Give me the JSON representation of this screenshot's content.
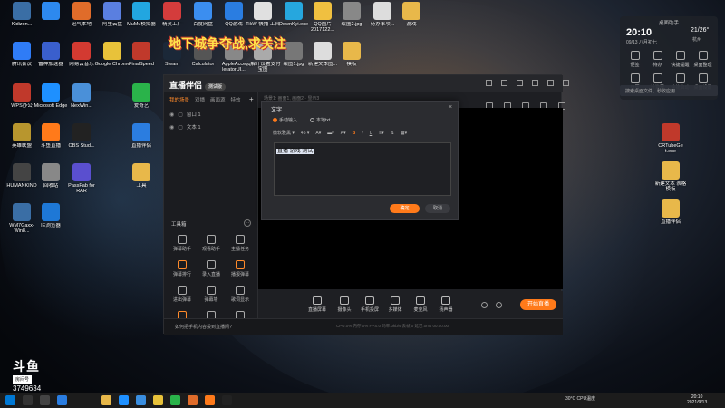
{
  "promo_text": "地下城争夺战,求关注",
  "desktop_icons": [
    {
      "label": "Kidizon...",
      "color": "#3a6ea5",
      "icon": "app-icon"
    },
    {
      "label": "",
      "color": "#2d89ef",
      "icon": "app-icon"
    },
    {
      "label": "迅气本地",
      "color": "#e06c2a",
      "icon": "app-icon"
    },
    {
      "label": "阿里云盘",
      "color": "#5a7fe0",
      "icon": "app-icon"
    },
    {
      "label": "MuMu模拟器",
      "color": "#22a6e0",
      "icon": "app-icon"
    },
    {
      "label": "精灵工厂",
      "color": "#d43c3c",
      "icon": "app-icon"
    },
    {
      "label": "百度网盘",
      "color": "#3b8ef0",
      "icon": "app-icon"
    },
    {
      "label": "QQ游戏",
      "color": "#2a7de1",
      "icon": "app-icon"
    },
    {
      "label": "TikW-快播 工具",
      "color": "#e0e0e0",
      "icon": "app-icon"
    },
    {
      "label": "DownKyi.exe",
      "color": "#26a7de",
      "icon": "app-icon"
    },
    {
      "label": "QQ图片2017122...",
      "color": "#f0c040",
      "icon": "image-icon"
    },
    {
      "label": "绘图2.jpg",
      "color": "#888",
      "icon": "image-icon"
    },
    {
      "label": "待办事项...",
      "color": "#ddd",
      "icon": "file-icon"
    },
    {
      "label": "游戏",
      "color": "#e8b84a",
      "icon": "folder-icon"
    },
    {
      "label": "腾讯会议",
      "color": "#2f7cf6",
      "icon": "app-icon"
    },
    {
      "label": "雷神加速器",
      "color": "#3a5fcd",
      "icon": "app-icon"
    },
    {
      "label": "网易云音乐",
      "color": "#d33a31",
      "icon": "app-icon"
    },
    {
      "label": "Google Chrome",
      "color": "#e8c23a",
      "icon": "chrome-icon"
    },
    {
      "label": "FinalSpeed",
      "color": "#c0392b",
      "icon": "app-icon"
    },
    {
      "label": "Steam",
      "color": "#1b2838",
      "icon": "steam-icon"
    },
    {
      "label": "Calculator",
      "color": "#555",
      "icon": "calculator-icon"
    },
    {
      "label": "AppleAcce leratorUI...",
      "color": "#888",
      "icon": "app-icon"
    },
    {
      "label": "qq解开设置支付宝图",
      "color": "#aaa",
      "icon": "app-icon"
    },
    {
      "label": "绘图1.jpg",
      "color": "#777",
      "icon": "image-icon"
    },
    {
      "label": "新建文本图...",
      "color": "#ddd",
      "icon": "file-icon"
    },
    {
      "label": "模板",
      "color": "#e8b84a",
      "icon": "folder-icon"
    },
    {
      "label": "WPS办公",
      "color": "#c0392b",
      "icon": "app-icon"
    },
    {
      "label": "Microsoft Edge",
      "color": "#1e90ff",
      "icon": "edge-icon"
    },
    {
      "label": "NexWin...",
      "color": "#4a90d9",
      "icon": "app-icon"
    },
    {
      "label": "爱奇艺",
      "color": "#2ab34a",
      "icon": "app-icon"
    },
    {
      "label": "英雄联盟",
      "color": "#b8962e",
      "icon": "app-icon"
    },
    {
      "label": "斗鱼直播",
      "color": "#ff7a1a",
      "icon": "app-icon"
    },
    {
      "label": "OBS Stud...",
      "color": "#222",
      "icon": "obs-icon"
    },
    {
      "label": "直播伴侣",
      "color": "#2b7de0",
      "icon": "app-icon"
    },
    {
      "label": "HUMANKIND",
      "color": "#444",
      "icon": "app-icon"
    },
    {
      "label": "回收站",
      "color": "#888",
      "icon": "recycle-bin-icon"
    },
    {
      "label": "PassFab for RAR",
      "color": "#5a4fcf",
      "icon": "app-icon"
    },
    {
      "label": "工具",
      "color": "#e8b84a",
      "icon": "folder-icon"
    },
    {
      "label": "WM7Gaxx-Win8...",
      "color": "#3a6ea5",
      "icon": "app-icon"
    },
    {
      "label": "IE浏览器",
      "color": "#1e78d6",
      "icon": "ie-icon"
    }
  ],
  "right_icons": [
    {
      "label": "CRTubeGe t.exe",
      "color": "#c0392b",
      "icon": "app-icon"
    },
    {
      "label": "新建文本 表格模板",
      "color": "#e8b84a",
      "icon": "folder-icon"
    },
    {
      "label": "直播伴侣",
      "color": "#e8b84a",
      "icon": "folder-icon"
    }
  ],
  "widget": {
    "title": "桌面助手",
    "time": "20:10",
    "date": "09/13 八月初七",
    "temp": "21/26°",
    "city": "杭州",
    "items": [
      "便签",
      "待办",
      "快捷提醒",
      "桌面整理",
      "日历",
      "计算器",
      "快捷启动",
      "桌面设置"
    ],
    "search_placeholder": "搜索桌面文件、秒收应用"
  },
  "app": {
    "title": "直播伴侣",
    "version_badge": "测试版",
    "left_tabs": [
      "我的场景",
      "双播",
      "画面源",
      "特效"
    ],
    "active_tab_index": 0,
    "scene_title": "场景1: 画面1, 画面2 · 显示3",
    "layers": [
      {
        "name": "窗口 1"
      },
      {
        "name": "文本 1"
      }
    ],
    "toolbox_title": "工具箱",
    "tools": [
      {
        "label": "弹幕助手",
        "is_new": false
      },
      {
        "label": "观看助手",
        "is_new": false
      },
      {
        "label": "主播任务",
        "is_new": false
      },
      {
        "label": "弹幕排行",
        "is_new": true
      },
      {
        "label": "录入直播",
        "is_new": false
      },
      {
        "label": "播报弹幕",
        "is_new": true
      },
      {
        "label": "进出弹幕",
        "is_new": false
      },
      {
        "label": "弹幕墙",
        "is_new": false
      },
      {
        "label": "歌词显示",
        "is_new": false
      },
      {
        "label": "更多",
        "is_new": true
      },
      {
        "label": "",
        "is_new": false
      },
      {
        "label": "",
        "is_new": false
      }
    ],
    "bottom_items": [
      "直播屏幕",
      "摄像头",
      "手机投屏",
      "多媒体",
      "麦克风",
      "扬声器"
    ],
    "start_button": "开始直播",
    "status_tip": "如何把手机内容投到直播间?",
    "status_stats": "CPU:0%  内存:0%  FPS:0  码率:0kb/s  丢帧:0  延迟:0ms  00:00:00"
  },
  "dialog": {
    "title": "文字",
    "radio_manual": "手动输入",
    "radio_file": "本地txt",
    "font": "微软雅黑",
    "size": "45",
    "text_value": "直播 游戏 测试",
    "ok": "确定",
    "cancel": "取消"
  },
  "watermark": {
    "logo": "斗鱼",
    "room_label": "房间号",
    "room_number": "3749634"
  },
  "taskbar": {
    "weather": "30°C CPU温度",
    "clock_time": "20:10",
    "clock_date": "2021/9/13"
  }
}
